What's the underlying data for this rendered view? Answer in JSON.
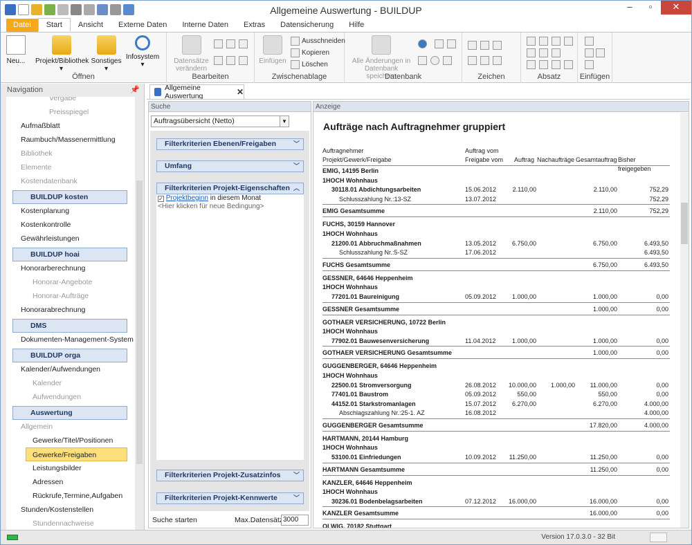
{
  "window": {
    "title": "Allgemeine Auswertung - BUILDUP"
  },
  "tabs": [
    "Datei",
    "Start",
    "Ansicht",
    "Externe Daten",
    "Interne Daten",
    "Extras",
    "Datensicherung",
    "Hilfe"
  ],
  "ribbon": {
    "oeffnen": {
      "label": "Öffnen",
      "neu": "Neu...",
      "projekt": "Projekt/Bibliothek",
      "sonstiges": "Sonstiges",
      "infosystem": "Infosystem"
    },
    "bearbeiten": {
      "label": "Bearbeiten",
      "datensaetze": "Datensätze",
      "veraendern": "verändern"
    },
    "zwischenablage": {
      "label": "Zwischenablage",
      "einfuegen": "Einfügen",
      "ausschneiden": "Ausschneiden",
      "kopieren": "Kopieren",
      "loeschen": "Löschen"
    },
    "datenbank": {
      "label": "Datenbank",
      "alle1": "Alle Änderungen in",
      "alle2": "Datenbank speichern"
    },
    "zeichen": {
      "label": "Zeichen"
    },
    "absatz": {
      "label": "Absatz"
    },
    "einfuegen": {
      "label": "Einfügen"
    }
  },
  "navigation": {
    "title": "Navigation",
    "items": [
      {
        "label": "Vergabe",
        "kind": "sub2"
      },
      {
        "label": "Preisspiegel",
        "kind": "sub2"
      },
      {
        "label": "Aufmaßblatt",
        "kind": "item"
      },
      {
        "label": "Raumbuch/Massenermittlung",
        "kind": "item"
      },
      {
        "label": "Bibliothek",
        "kind": "dis"
      },
      {
        "label": "Elemente",
        "kind": "dis"
      },
      {
        "label": "Kostendatenbank",
        "kind": "dis"
      },
      {
        "label": "BUILDUP kosten",
        "kind": "hdr"
      },
      {
        "label": "Kostenplanung",
        "kind": "item"
      },
      {
        "label": "Kostenkontrolle",
        "kind": "item"
      },
      {
        "label": "Gewährleistungen",
        "kind": "item"
      },
      {
        "label": "BUILDUP hoai",
        "kind": "hdr"
      },
      {
        "label": "Honorarberechnung",
        "kind": "item"
      },
      {
        "label": "Honorar-Angebote",
        "kind": "sub"
      },
      {
        "label": "Honorar-Aufträge",
        "kind": "sub"
      },
      {
        "label": "Honorarabrechnung",
        "kind": "item"
      },
      {
        "label": "DMS",
        "kind": "hdr"
      },
      {
        "label": "Dokumenten-Management-System",
        "kind": "item"
      },
      {
        "label": "BUILDUP orga",
        "kind": "hdr"
      },
      {
        "label": "Kalender/Aufwendungen",
        "kind": "item"
      },
      {
        "label": "Kalender",
        "kind": "sub"
      },
      {
        "label": "Aufwendungen",
        "kind": "sub"
      },
      {
        "label": "Auswertung",
        "kind": "hdr"
      },
      {
        "label": "Allgemein",
        "kind": "dis"
      },
      {
        "label": "Gewerke/Titel/Positionen",
        "kind": "subn"
      },
      {
        "label": "Gewerke/Freigaben",
        "kind": "sel"
      },
      {
        "label": "Leistungsbilder",
        "kind": "subn"
      },
      {
        "label": "Adressen",
        "kind": "subn"
      },
      {
        "label": "Rückrufe,Termine,Aufgaben",
        "kind": "subn"
      },
      {
        "label": "Stunden/Kostenstellen",
        "kind": "item"
      },
      {
        "label": "Stundennachweise",
        "kind": "sub"
      }
    ]
  },
  "doctab": {
    "label": "Allgemeine Auswertung"
  },
  "search": {
    "title": "Suche",
    "combo": "Auftragsübersicht (Netto)",
    "panels": [
      "Filterkriterien Ebenen/Freigaben",
      "Umfang",
      "Filterkriterien Projekt-Eigenschaften",
      "Filterkriterien Projekt-Zusatzinfos",
      "Filterkriterien Projekt-Kennwerte"
    ],
    "cond_link": "Projektbeginn",
    "cond_rest": " in diesem Monat",
    "cond_new": "<Hier klicken für neue Bedingung>",
    "start": "Suche starten",
    "max_label": "Max.Datensätze",
    "max_value": "3000"
  },
  "report": {
    "pane_title": "Anzeige",
    "title": "Aufträge nach Auftragnehmer gruppiert",
    "h1a": "Auftragnehmer",
    "h1b": "Auftrag vom",
    "h2a": "Projekt/Gewerk/Freigabe",
    "h2b": "Freigabe vom",
    "h2c": "Auftrag",
    "h2d": "Nachaufträge",
    "h2e": "Gesamtauftrag",
    "h2f": "Bisher freigegeben",
    "rows": [
      {
        "t": "g",
        "a": "EMIG, 14195 Berlin"
      },
      {
        "t": "p",
        "a": "1HOCH Wohnhaus"
      },
      {
        "t": "w",
        "a": "30118.01 Abdichtungsarbeiten",
        "b": "15.06.2012",
        "c": "2.110,00",
        "d": "",
        "e": "2.110,00",
        "f": "752,29"
      },
      {
        "t": "f",
        "a": "Schlusszahlung Nr.:13-SZ",
        "b": "13.07.2012",
        "c": "",
        "d": "",
        "e": "",
        "f": "752,29"
      },
      {
        "t": "s",
        "a": "EMIG Gesamtsumme",
        "e": "2.110,00",
        "f": "752,29"
      },
      {
        "t": "g",
        "a": "FUCHS, 30159 Hannover"
      },
      {
        "t": "p",
        "a": "1HOCH Wohnhaus"
      },
      {
        "t": "w",
        "a": "21200.01 Abbruchmaßnahmen",
        "b": "13.05.2012",
        "c": "6.750,00",
        "d": "",
        "e": "6.750,00",
        "f": "6.493,50"
      },
      {
        "t": "f",
        "a": "Schlusszahlung Nr.:5-SZ",
        "b": "17.06.2012",
        "c": "",
        "d": "",
        "e": "",
        "f": "6.493,50"
      },
      {
        "t": "s",
        "a": "FUCHS Gesamtsumme",
        "e": "6.750,00",
        "f": "6.493,50"
      },
      {
        "t": "g",
        "a": "GESSNER, 64646 Heppenheim"
      },
      {
        "t": "p",
        "a": "1HOCH Wohnhaus"
      },
      {
        "t": "w",
        "a": "77201.01 Baureinigung",
        "b": "05.09.2012",
        "c": "1.000,00",
        "d": "",
        "e": "1.000,00",
        "f": "0,00"
      },
      {
        "t": "s",
        "a": "GESSNER Gesamtsumme",
        "e": "1.000,00",
        "f": "0,00"
      },
      {
        "t": "g",
        "a": "GOTHAER VERSICHERUNG, 10722 Berlin"
      },
      {
        "t": "p",
        "a": "1HOCH Wohnhaus"
      },
      {
        "t": "w",
        "a": "77902.01 Bauwesenversicherung",
        "b": "11.04.2012",
        "c": "1.000,00",
        "d": "",
        "e": "1.000,00",
        "f": "0,00"
      },
      {
        "t": "s",
        "a": "GOTHAER VERSICHERUNG Gesamtsumme",
        "e": "1.000,00",
        "f": "0,00"
      },
      {
        "t": "g",
        "a": "GUGGENBERGER, 64646 Heppenheim"
      },
      {
        "t": "p",
        "a": "1HOCH Wohnhaus"
      },
      {
        "t": "w",
        "a": "22500.01 Stromversorgung",
        "b": "26.08.2012",
        "c": "10.000,00",
        "d": "1.000,00",
        "e": "11.000,00",
        "f": "0,00"
      },
      {
        "t": "w",
        "a": "77401.01 Baustrom",
        "b": "05.09.2012",
        "c": "550,00",
        "d": "",
        "e": "550,00",
        "f": "0,00"
      },
      {
        "t": "w",
        "a": "44152.01 Starkstromanlagen",
        "b": "15.07.2012",
        "c": "6.270,00",
        "d": "",
        "e": "6.270,00",
        "f": "4.000,00"
      },
      {
        "t": "f",
        "a": "Abschlagszahlung Nr.:25-1. AZ",
        "b": "16.08.2012",
        "c": "",
        "d": "",
        "e": "",
        "f": "4.000,00"
      },
      {
        "t": "s",
        "a": "GUGGENBERGER Gesamtsumme",
        "e": "17.820,00",
        "f": "4.000,00"
      },
      {
        "t": "g",
        "a": "HARTMANN, 20144 Hamburg"
      },
      {
        "t": "p",
        "a": "1HOCH Wohnhaus"
      },
      {
        "t": "w",
        "a": "53100.01 Einfriedungen",
        "b": "10.09.2012",
        "c": "11.250,00",
        "d": "",
        "e": "11.250,00",
        "f": "0,00"
      },
      {
        "t": "s",
        "a": "HARTMANN Gesamtsumme",
        "e": "11.250,00",
        "f": "0,00"
      },
      {
        "t": "g",
        "a": "KANZLER, 64646 Heppenheim"
      },
      {
        "t": "p",
        "a": "1HOCH Wohnhaus"
      },
      {
        "t": "w",
        "a": "30236.01 Bodenbelagsarbeiten",
        "b": "07.12.2012",
        "c": "16.000,00",
        "d": "",
        "e": "16.000,00",
        "f": "0,00"
      },
      {
        "t": "s",
        "a": "KANZLER Gesamtsumme",
        "e": "16.000,00",
        "f": "0,00"
      },
      {
        "t": "g",
        "a": "OLWIG, 70182 Stuttgart"
      }
    ]
  },
  "status": {
    "version": "Version 17.0.3.0 - 32 Bit"
  }
}
